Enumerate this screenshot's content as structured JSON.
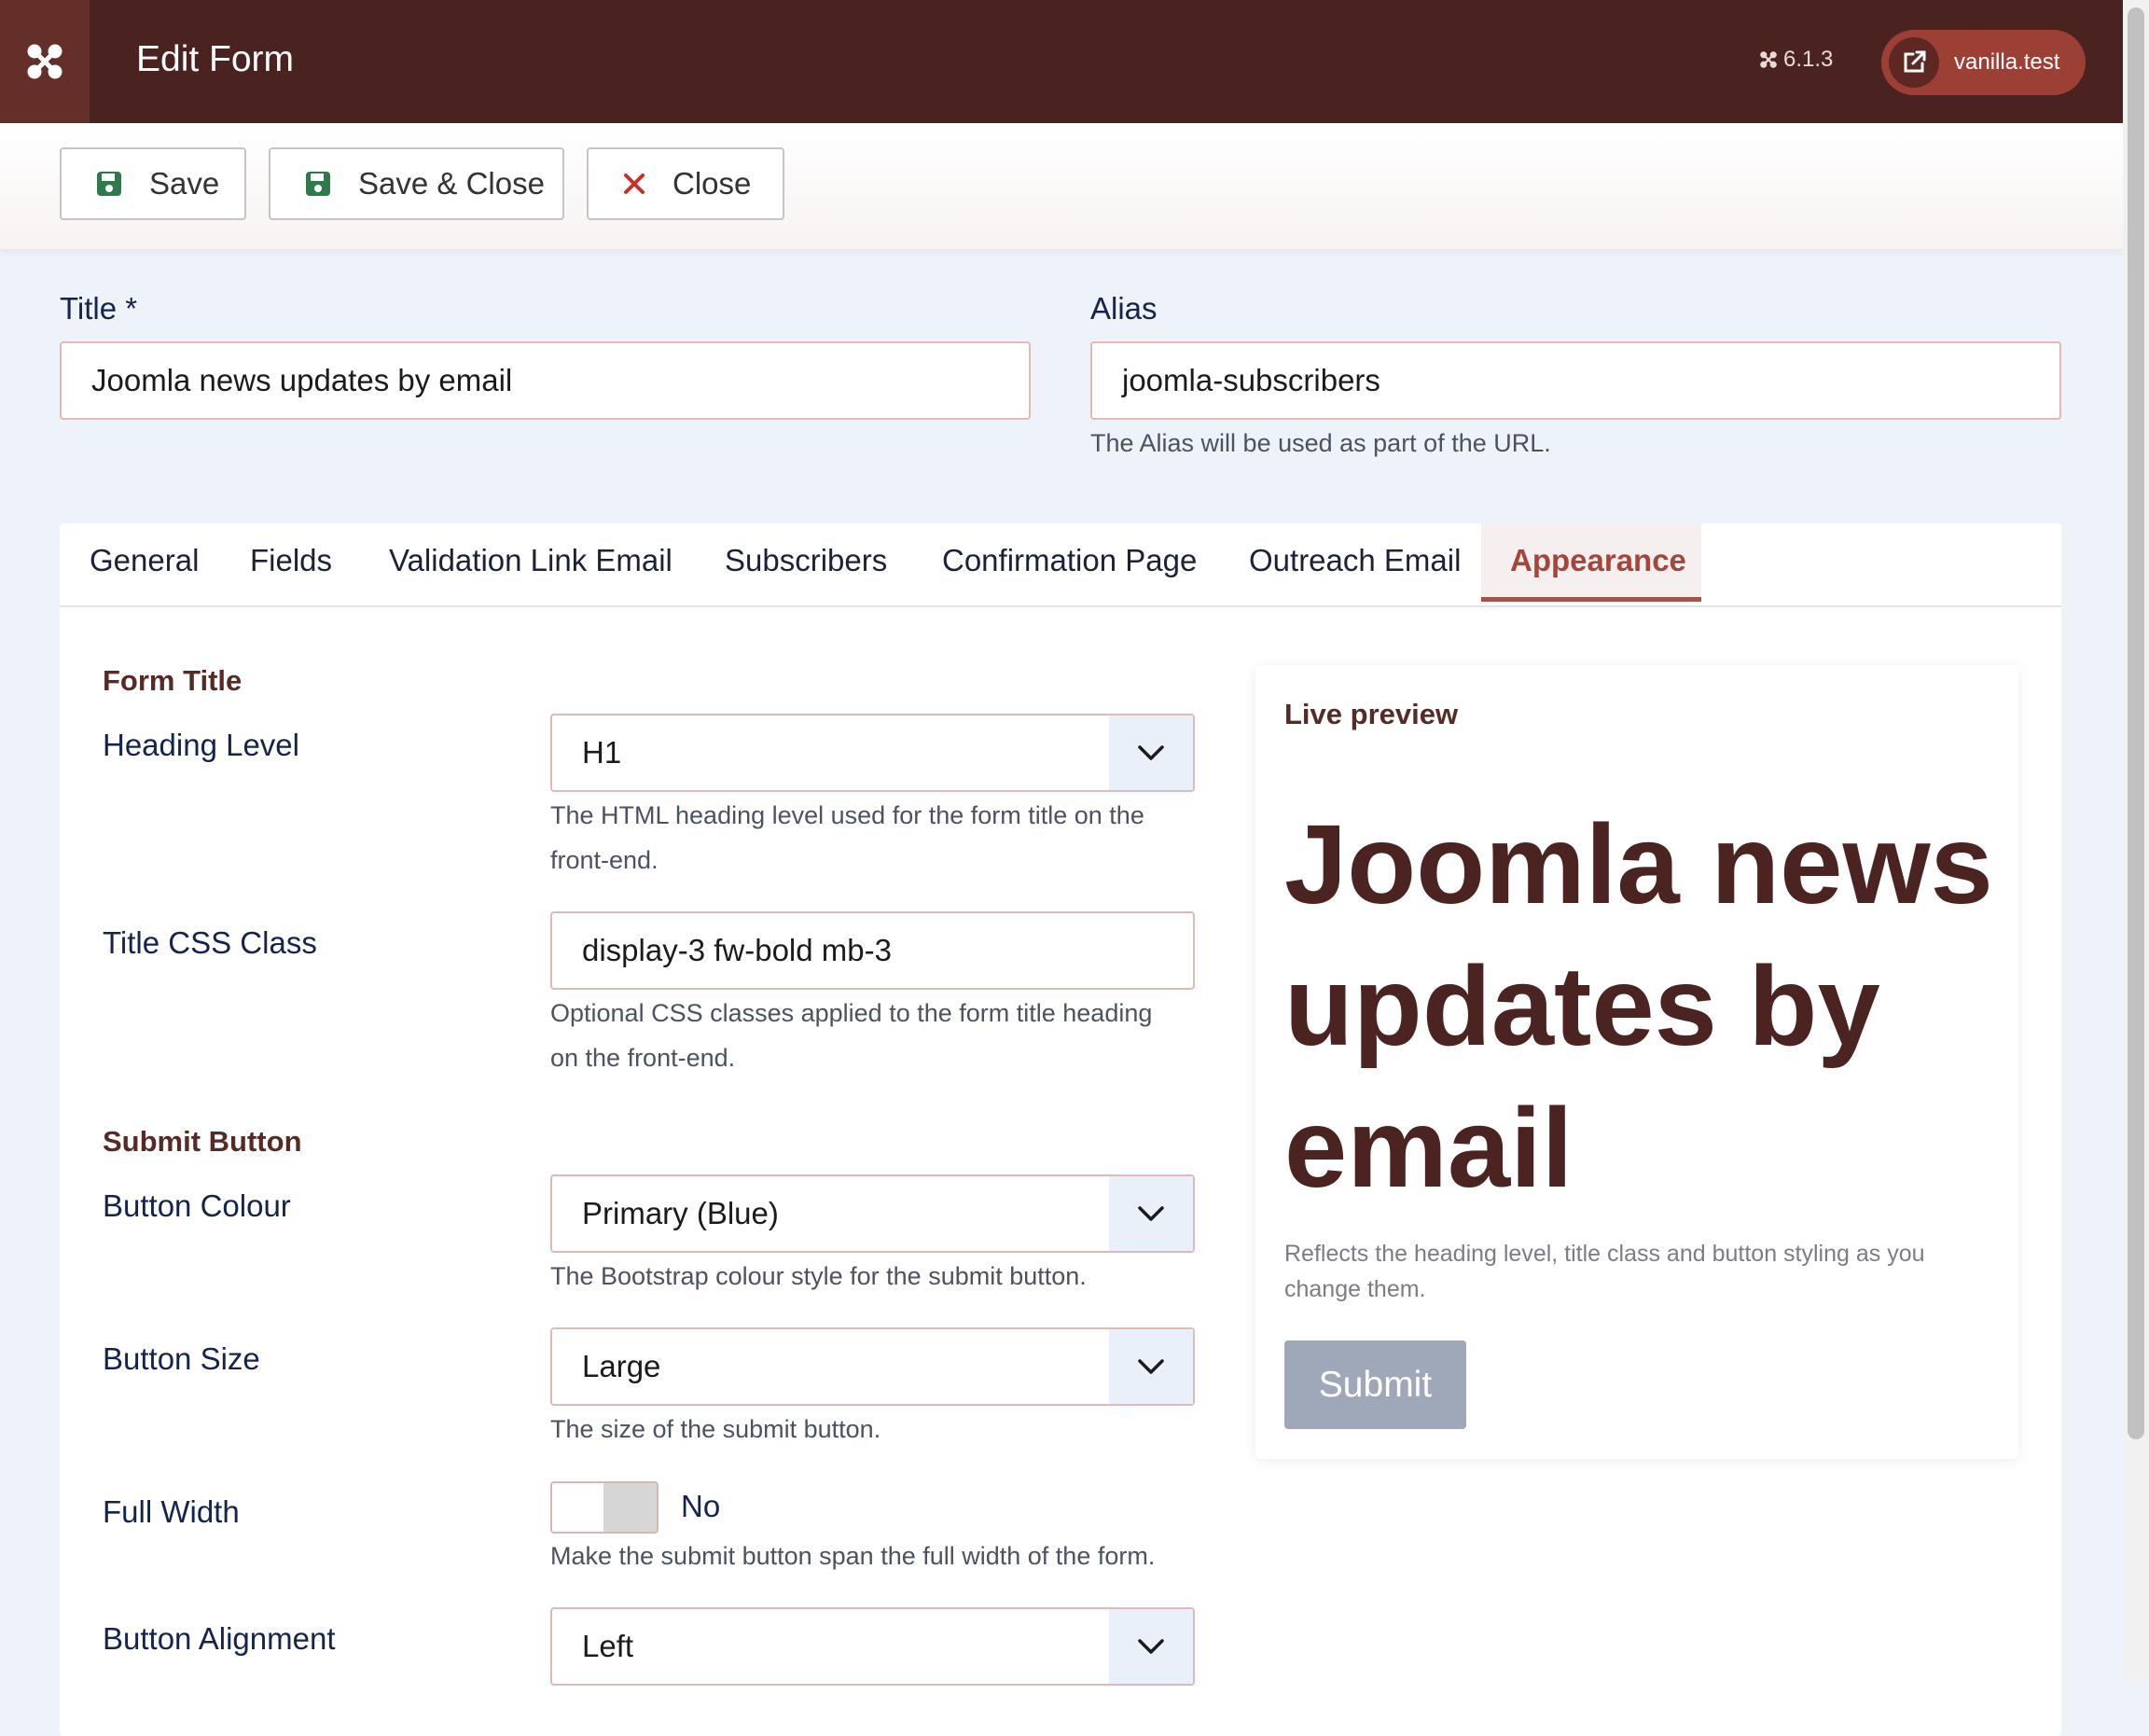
{
  "header": {
    "title": "Edit Form",
    "version": "6.1.3",
    "site_label": "vanilla.test"
  },
  "toolbar": {
    "save_label": "Save",
    "save_close_label": "Save & Close",
    "close_label": "Close"
  },
  "fields": {
    "title_label": "Title *",
    "title_value": "Joomla news updates by email",
    "alias_label": "Alias",
    "alias_value": "joomla-subscribers",
    "alias_hint": "The Alias will be used as part of the URL."
  },
  "tabs": [
    {
      "label": "General"
    },
    {
      "label": "Fields"
    },
    {
      "label": "Validation Link Email"
    },
    {
      "label": "Subscribers"
    },
    {
      "label": "Confirmation Page"
    },
    {
      "label": "Outreach Email"
    },
    {
      "label": "Appearance",
      "active": true
    }
  ],
  "appearance": {
    "form_title_section": "Form Title",
    "heading_level_label": "Heading Level",
    "heading_level_value": "H1",
    "heading_level_hint_1": "The HTML heading level used for the form title on the",
    "heading_level_hint_2": "front-end.",
    "title_css_label": "Title CSS Class",
    "title_css_value": "display-3 fw-bold mb-3",
    "title_css_hint_1": "Optional CSS classes applied to the form title heading",
    "title_css_hint_2": "on the front-end.",
    "submit_section": "Submit Button",
    "button_colour_label": "Button Colour",
    "button_colour_value": "Primary (Blue)",
    "button_colour_hint": "The Bootstrap colour style for the submit button.",
    "button_size_label": "Button Size",
    "button_size_value": "Large",
    "button_size_hint": "The size of the submit button.",
    "full_width_label": "Full Width",
    "full_width_value": "No",
    "full_width_hint": "Make the submit button span the full width of the form.",
    "button_alignment_label": "Button Alignment",
    "button_alignment_value": "Left"
  },
  "preview": {
    "label": "Live preview",
    "title_line1": "Joomla news",
    "title_line2": "updates by",
    "title_line3": "email",
    "description_1": "Reflects the heading level, title class and button styling as you",
    "description_2": "change them.",
    "submit_label": "Submit"
  },
  "colors": {
    "header_bg": "#4a2320",
    "accent": "#a5453c",
    "save_icon": "#2f7a4b",
    "close_icon": "#c9302c"
  },
  "icons": {
    "logo": "joomla-logo-icon",
    "external": "external-link-icon",
    "save": "floppy-disk-icon",
    "close": "close-x-icon",
    "dropdown": "chevron-down-icon"
  }
}
